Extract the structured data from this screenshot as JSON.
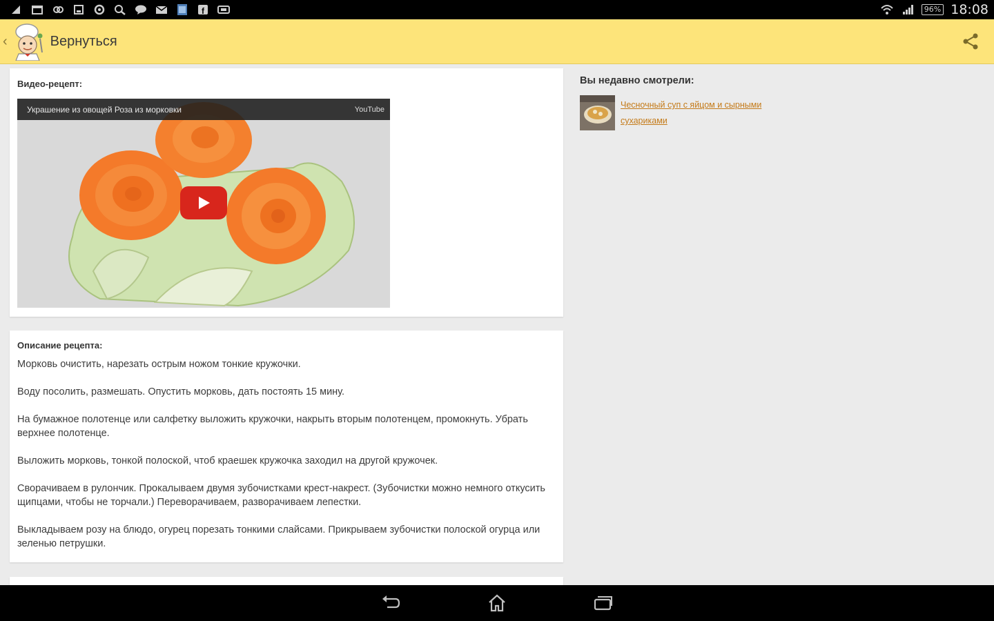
{
  "status_bar": {
    "left_icons": [
      "notification-icon",
      "calendar-icon",
      "sync-icon",
      "download-icon",
      "settings-icon",
      "search-icon",
      "chat-icon",
      "mail-icon",
      "image-icon",
      "facebook-icon",
      "screen-icon"
    ],
    "battery": "96%",
    "time": "18:08"
  },
  "app_bar": {
    "back_label": "Вернуться",
    "background_color": "#fde47a"
  },
  "video_card": {
    "title": "Видео-рецепт:",
    "video_title": "Украшение из овощей Роза из морковки",
    "video_brand": "YouTube"
  },
  "description": {
    "title": "Описание рецепта:",
    "paragraphs": [
      "Морковь очистить, нарезать острым ножом тонкие кружочки.",
      "Воду посолить, размешать. Опустить морковь, дать постоять 15 мину.",
      "На бумажное полотенце или салфетку выложить кружочки, накрыть вторым полотенцем, промокнуть. Убрать верхнее полотенце.",
      "Выложить морковь, тонкой полоской, чтоб краешек кружочка заходил на другой кружочек.",
      "Сворачиваем в рулончик. Прокалываем двумя зубочистками крест-накрест. (Зубочистки можно немного откусить щипцами, чтобы не торчали.) Переворачиваем, разворачиваем лепестки.",
      "Выкладываем розу на блюдо, огурец порезать тонкими слайсами. Прикрываем зубочистки полоской огурца или зеленью петрушки."
    ]
  },
  "recent": {
    "title": "Вы недавно смотрели:",
    "items": [
      {
        "label": "Чесночный суп с яйцом и сырными сухариками"
      }
    ],
    "link_color": "#c47a18"
  }
}
